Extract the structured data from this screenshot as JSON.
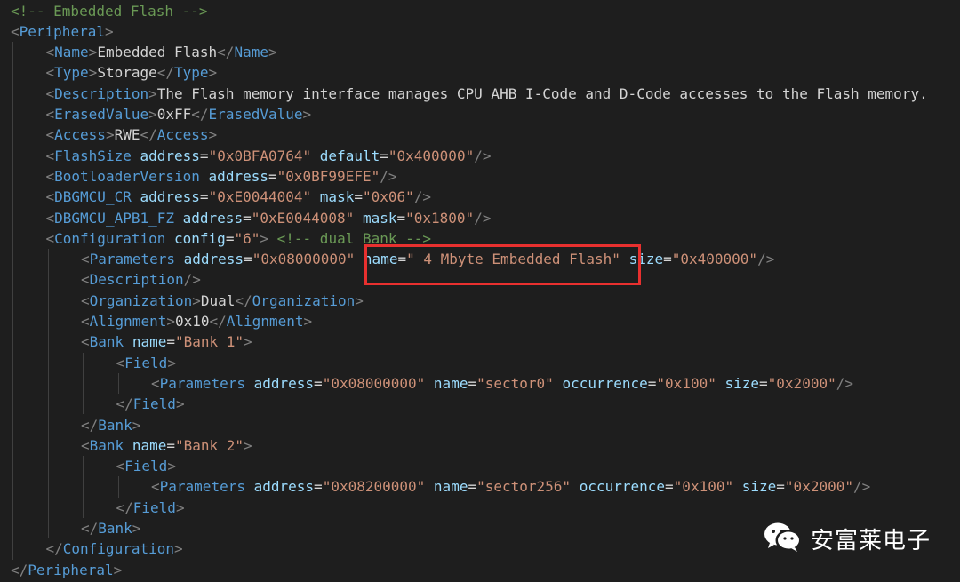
{
  "colors": {
    "background": "#1e1e1e",
    "comment": "#6a9955",
    "bracket": "#808080",
    "tag": "#569cd6",
    "attribute": "#9cdcfe",
    "value": "#ce9178",
    "text": "#d4d4d4",
    "highlight": "#e8302f"
  },
  "code_lines": [
    {
      "indent": 0,
      "tokens": [
        {
          "t": "c",
          "v": "<!-- Embedded Flash -->"
        }
      ]
    },
    {
      "indent": 0,
      "tokens": [
        {
          "t": "p",
          "v": "<"
        },
        {
          "t": "k",
          "v": "Peripheral"
        },
        {
          "t": "p",
          "v": ">"
        }
      ]
    },
    {
      "indent": 1,
      "tokens": [
        {
          "t": "p",
          "v": "<"
        },
        {
          "t": "k",
          "v": "Name"
        },
        {
          "t": "p",
          "v": ">"
        },
        {
          "t": "x",
          "v": "Embedded Flash"
        },
        {
          "t": "p",
          "v": "</"
        },
        {
          "t": "k",
          "v": "Name"
        },
        {
          "t": "p",
          "v": ">"
        }
      ]
    },
    {
      "indent": 1,
      "tokens": [
        {
          "t": "p",
          "v": "<"
        },
        {
          "t": "k",
          "v": "Type"
        },
        {
          "t": "p",
          "v": ">"
        },
        {
          "t": "x",
          "v": "Storage"
        },
        {
          "t": "p",
          "v": "</"
        },
        {
          "t": "k",
          "v": "Type"
        },
        {
          "t": "p",
          "v": ">"
        }
      ]
    },
    {
      "indent": 1,
      "tokens": [
        {
          "t": "p",
          "v": "<"
        },
        {
          "t": "k",
          "v": "Description"
        },
        {
          "t": "p",
          "v": ">"
        },
        {
          "t": "x",
          "v": "The Flash memory interface manages CPU AHB I-Code and D-Code accesses to the Flash memory."
        }
      ]
    },
    {
      "indent": 1,
      "tokens": [
        {
          "t": "p",
          "v": "<"
        },
        {
          "t": "k",
          "v": "ErasedValue"
        },
        {
          "t": "p",
          "v": ">"
        },
        {
          "t": "x",
          "v": "0xFF"
        },
        {
          "t": "p",
          "v": "</"
        },
        {
          "t": "k",
          "v": "ErasedValue"
        },
        {
          "t": "p",
          "v": ">"
        }
      ]
    },
    {
      "indent": 1,
      "tokens": [
        {
          "t": "p",
          "v": "<"
        },
        {
          "t": "k",
          "v": "Access"
        },
        {
          "t": "p",
          "v": ">"
        },
        {
          "t": "x",
          "v": "RWE"
        },
        {
          "t": "p",
          "v": "</"
        },
        {
          "t": "k",
          "v": "Access"
        },
        {
          "t": "p",
          "v": ">"
        }
      ]
    },
    {
      "indent": 1,
      "tokens": [
        {
          "t": "p",
          "v": "<"
        },
        {
          "t": "k",
          "v": "FlashSize"
        },
        {
          "t": "x",
          "v": " "
        },
        {
          "t": "a",
          "v": "address"
        },
        {
          "t": "x",
          "v": "="
        },
        {
          "t": "s",
          "v": "\"0x0BFA0764\""
        },
        {
          "t": "x",
          "v": " "
        },
        {
          "t": "a",
          "v": "default"
        },
        {
          "t": "x",
          "v": "="
        },
        {
          "t": "s",
          "v": "\"0x400000\""
        },
        {
          "t": "p",
          "v": "/>"
        }
      ]
    },
    {
      "indent": 1,
      "tokens": [
        {
          "t": "p",
          "v": "<"
        },
        {
          "t": "k",
          "v": "BootloaderVersion"
        },
        {
          "t": "x",
          "v": " "
        },
        {
          "t": "a",
          "v": "address"
        },
        {
          "t": "x",
          "v": "="
        },
        {
          "t": "s",
          "v": "\"0x0BF99EFE\""
        },
        {
          "t": "p",
          "v": "/>"
        }
      ]
    },
    {
      "indent": 1,
      "tokens": [
        {
          "t": "p",
          "v": "<"
        },
        {
          "t": "k",
          "v": "DBGMCU_CR"
        },
        {
          "t": "x",
          "v": " "
        },
        {
          "t": "a",
          "v": "address"
        },
        {
          "t": "x",
          "v": "="
        },
        {
          "t": "s",
          "v": "\"0xE0044004\""
        },
        {
          "t": "x",
          "v": " "
        },
        {
          "t": "a",
          "v": "mask"
        },
        {
          "t": "x",
          "v": "="
        },
        {
          "t": "s",
          "v": "\"0x06\""
        },
        {
          "t": "p",
          "v": "/>"
        }
      ]
    },
    {
      "indent": 1,
      "tokens": [
        {
          "t": "p",
          "v": "<"
        },
        {
          "t": "k",
          "v": "DBGMCU_APB1_FZ"
        },
        {
          "t": "x",
          "v": " "
        },
        {
          "t": "a",
          "v": "address"
        },
        {
          "t": "x",
          "v": "="
        },
        {
          "t": "s",
          "v": "\"0xE0044008\""
        },
        {
          "t": "x",
          "v": " "
        },
        {
          "t": "a",
          "v": "mask"
        },
        {
          "t": "x",
          "v": "="
        },
        {
          "t": "s",
          "v": "\"0x1800\""
        },
        {
          "t": "p",
          "v": "/>"
        }
      ]
    },
    {
      "indent": 1,
      "tokens": [
        {
          "t": "p",
          "v": "<"
        },
        {
          "t": "k",
          "v": "Configuration"
        },
        {
          "t": "x",
          "v": " "
        },
        {
          "t": "a",
          "v": "config"
        },
        {
          "t": "x",
          "v": "="
        },
        {
          "t": "s",
          "v": "\"6\""
        },
        {
          "t": "p",
          "v": ">"
        },
        {
          "t": "x",
          "v": " "
        },
        {
          "t": "c",
          "v": "<!-- dual Bank -->"
        }
      ]
    },
    {
      "indent": 2,
      "tokens": [
        {
          "t": "p",
          "v": "<"
        },
        {
          "t": "k",
          "v": "Parameters"
        },
        {
          "t": "x",
          "v": " "
        },
        {
          "t": "a",
          "v": "address"
        },
        {
          "t": "x",
          "v": "="
        },
        {
          "t": "s",
          "v": "\"0x08000000\""
        },
        {
          "t": "x",
          "v": " "
        },
        {
          "t": "a",
          "v": "name"
        },
        {
          "t": "x",
          "v": "="
        },
        {
          "t": "s",
          "v": "\" 4 Mbyte Embedded Flash\""
        },
        {
          "t": "x",
          "v": " "
        },
        {
          "t": "a",
          "v": "size"
        },
        {
          "t": "x",
          "v": "="
        },
        {
          "t": "s",
          "v": "\"0x400000\""
        },
        {
          "t": "p",
          "v": "/>"
        }
      ]
    },
    {
      "indent": 2,
      "tokens": [
        {
          "t": "p",
          "v": "<"
        },
        {
          "t": "k",
          "v": "Description"
        },
        {
          "t": "p",
          "v": "/>"
        }
      ]
    },
    {
      "indent": 2,
      "tokens": [
        {
          "t": "p",
          "v": "<"
        },
        {
          "t": "k",
          "v": "Organization"
        },
        {
          "t": "p",
          "v": ">"
        },
        {
          "t": "x",
          "v": "Dual"
        },
        {
          "t": "p",
          "v": "</"
        },
        {
          "t": "k",
          "v": "Organization"
        },
        {
          "t": "p",
          "v": ">"
        }
      ]
    },
    {
      "indent": 2,
      "tokens": [
        {
          "t": "p",
          "v": "<"
        },
        {
          "t": "k",
          "v": "Alignment"
        },
        {
          "t": "p",
          "v": ">"
        },
        {
          "t": "x",
          "v": "0x10"
        },
        {
          "t": "p",
          "v": "</"
        },
        {
          "t": "k",
          "v": "Alignment"
        },
        {
          "t": "p",
          "v": ">"
        }
      ]
    },
    {
      "indent": 2,
      "tokens": [
        {
          "t": "p",
          "v": "<"
        },
        {
          "t": "k",
          "v": "Bank"
        },
        {
          "t": "x",
          "v": " "
        },
        {
          "t": "a",
          "v": "name"
        },
        {
          "t": "x",
          "v": "="
        },
        {
          "t": "s",
          "v": "\"Bank 1\""
        },
        {
          "t": "p",
          "v": ">"
        }
      ]
    },
    {
      "indent": 3,
      "tokens": [
        {
          "t": "p",
          "v": "<"
        },
        {
          "t": "k",
          "v": "Field"
        },
        {
          "t": "p",
          "v": ">"
        }
      ]
    },
    {
      "indent": 4,
      "tokens": [
        {
          "t": "p",
          "v": "<"
        },
        {
          "t": "k",
          "v": "Parameters"
        },
        {
          "t": "x",
          "v": " "
        },
        {
          "t": "a",
          "v": "address"
        },
        {
          "t": "x",
          "v": "="
        },
        {
          "t": "s",
          "v": "\"0x08000000\""
        },
        {
          "t": "x",
          "v": " "
        },
        {
          "t": "a",
          "v": "name"
        },
        {
          "t": "x",
          "v": "="
        },
        {
          "t": "s",
          "v": "\"sector0\""
        },
        {
          "t": "x",
          "v": " "
        },
        {
          "t": "a",
          "v": "occurrence"
        },
        {
          "t": "x",
          "v": "="
        },
        {
          "t": "s",
          "v": "\"0x100\""
        },
        {
          "t": "x",
          "v": " "
        },
        {
          "t": "a",
          "v": "size"
        },
        {
          "t": "x",
          "v": "="
        },
        {
          "t": "s",
          "v": "\"0x2000\""
        },
        {
          "t": "p",
          "v": "/>"
        }
      ]
    },
    {
      "indent": 3,
      "tokens": [
        {
          "t": "p",
          "v": "</"
        },
        {
          "t": "k",
          "v": "Field"
        },
        {
          "t": "p",
          "v": ">"
        }
      ]
    },
    {
      "indent": 2,
      "tokens": [
        {
          "t": "p",
          "v": "</"
        },
        {
          "t": "k",
          "v": "Bank"
        },
        {
          "t": "p",
          "v": ">"
        }
      ]
    },
    {
      "indent": 2,
      "tokens": [
        {
          "t": "p",
          "v": "<"
        },
        {
          "t": "k",
          "v": "Bank"
        },
        {
          "t": "x",
          "v": " "
        },
        {
          "t": "a",
          "v": "name"
        },
        {
          "t": "x",
          "v": "="
        },
        {
          "t": "s",
          "v": "\"Bank 2\""
        },
        {
          "t": "p",
          "v": ">"
        }
      ]
    },
    {
      "indent": 3,
      "tokens": [
        {
          "t": "p",
          "v": "<"
        },
        {
          "t": "k",
          "v": "Field"
        },
        {
          "t": "p",
          "v": ">"
        }
      ]
    },
    {
      "indent": 4,
      "tokens": [
        {
          "t": "p",
          "v": "<"
        },
        {
          "t": "k",
          "v": "Parameters"
        },
        {
          "t": "x",
          "v": " "
        },
        {
          "t": "a",
          "v": "address"
        },
        {
          "t": "x",
          "v": "="
        },
        {
          "t": "s",
          "v": "\"0x08200000\""
        },
        {
          "t": "x",
          "v": " "
        },
        {
          "t": "a",
          "v": "name"
        },
        {
          "t": "x",
          "v": "="
        },
        {
          "t": "s",
          "v": "\"sector256\""
        },
        {
          "t": "x",
          "v": " "
        },
        {
          "t": "a",
          "v": "occurrence"
        },
        {
          "t": "x",
          "v": "="
        },
        {
          "t": "s",
          "v": "\"0x100\""
        },
        {
          "t": "x",
          "v": " "
        },
        {
          "t": "a",
          "v": "size"
        },
        {
          "t": "x",
          "v": "="
        },
        {
          "t": "s",
          "v": "\"0x2000\""
        },
        {
          "t": "p",
          "v": "/>"
        }
      ]
    },
    {
      "indent": 3,
      "tokens": [
        {
          "t": "p",
          "v": "</"
        },
        {
          "t": "k",
          "v": "Field"
        },
        {
          "t": "p",
          "v": ">"
        }
      ]
    },
    {
      "indent": 2,
      "tokens": [
        {
          "t": "p",
          "v": "</"
        },
        {
          "t": "k",
          "v": "Bank"
        },
        {
          "t": "p",
          "v": ">"
        }
      ]
    },
    {
      "indent": 1,
      "tokens": [
        {
          "t": "p",
          "v": "</"
        },
        {
          "t": "k",
          "v": "Configuration"
        },
        {
          "t": "p",
          "v": ">"
        }
      ]
    },
    {
      "indent": 0,
      "tokens": [
        {
          "t": "p",
          "v": "</"
        },
        {
          "t": "k",
          "v": "Peripheral"
        },
        {
          "t": "p",
          "v": ">"
        }
      ]
    }
  ],
  "watermark": {
    "icon": "wechat-icon",
    "text": "安富莱电子"
  }
}
